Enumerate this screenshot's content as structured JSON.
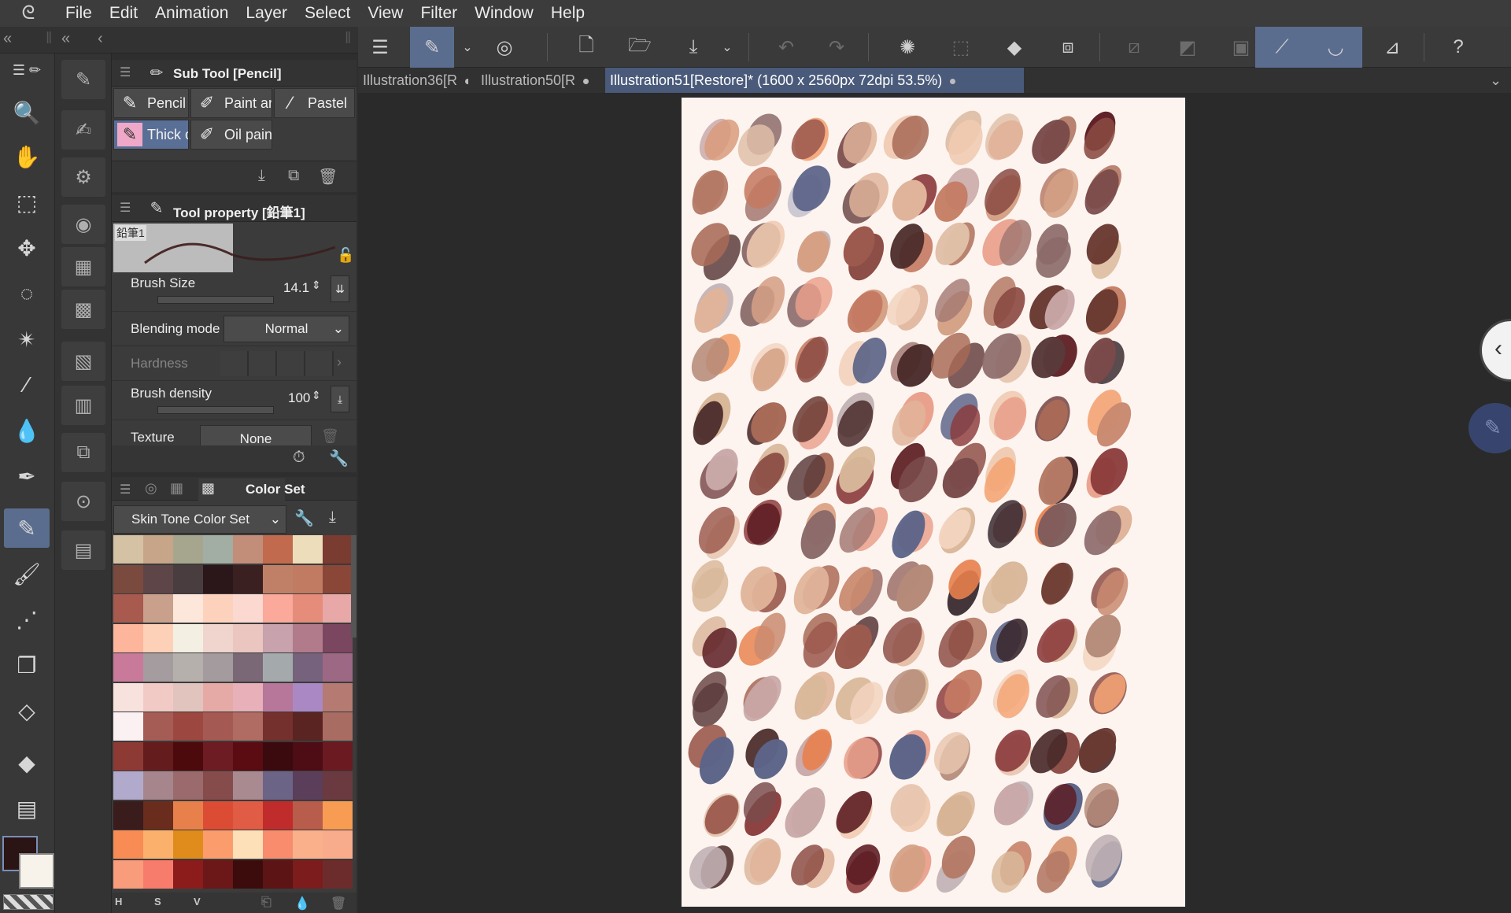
{
  "menubar": {
    "items": [
      "File",
      "Edit",
      "Animation",
      "Layer",
      "Select",
      "View",
      "Filter",
      "Window",
      "Help"
    ]
  },
  "tabs": [
    {
      "label": "Illustration36[R",
      "active": false
    },
    {
      "label": "Illustration50[R",
      "active": false
    },
    {
      "label": "Illustration51[Restore]* (1600 x 2560px 72dpi 53.5%)",
      "active": true
    }
  ],
  "subtool": {
    "title": "Sub Tool [Pencil]",
    "items": [
      {
        "label": "Pencil",
        "icon": "pencil-icon"
      },
      {
        "label": "Paint ar",
        "icon": "paint-icon"
      },
      {
        "label": "Pastel",
        "icon": "pastel-icon"
      },
      {
        "label": "Thick o",
        "icon": "thick-pencil-icon",
        "selected": true
      },
      {
        "label": "Oil pain",
        "icon": "oil-paint-icon"
      }
    ]
  },
  "toolprop": {
    "title": "Tool property [鉛筆1]",
    "preset_name": "鉛筆1",
    "brush_size_label": "Brush Size",
    "brush_size_value": "14.1",
    "blending_label": "Blending mode",
    "blending_value": "Normal",
    "hardness_label": "Hardness",
    "density_label": "Brush density",
    "density_value": "100",
    "texture_label": "Texture",
    "texture_value": "None"
  },
  "colorset": {
    "title": "Color Set",
    "set_name": "Skin Tone Color Set",
    "footer": [
      "H",
      "S",
      "V"
    ],
    "swatches": [
      [
        "#d5c1a3",
        "#c7a588",
        "#a6a68f",
        "#a2ada3",
        "#c28e7a",
        "#c26a4d",
        "#eeddba",
        "#7a3b31"
      ],
      [
        "#7a4a3e",
        "#5e4548",
        "#4a3d40",
        "#2b1619",
        "#3b2022",
        "#c08068",
        "#c07b62",
        "#8a4636"
      ],
      [
        "#a85a4e",
        "#c9a08c",
        "#fde7db",
        "#fdd2bd",
        "#fbd9d0",
        "#faa99b",
        "#e58c7a",
        "#e8a8a8"
      ],
      [
        "#fdb59b",
        "#fdd0b8",
        "#f3f0e3",
        "#efd5cd",
        "#ebc6c1",
        "#c8a2ad",
        "#b17b8c",
        "#7a4660"
      ],
      [
        "#c97a9a",
        "#a59c9f",
        "#b5b0ab",
        "#a49b9e",
        "#7a6876",
        "#a4aaab",
        "#76627c",
        "#9c6884"
      ],
      [
        "#f8e2dd",
        "#f2cac5",
        "#e2c4be",
        "#e6aaa6",
        "#e8b0b8",
        "#b7779a",
        "#aa88c4",
        "#b57a72"
      ],
      [
        "#fbf0f2",
        "#a55c54",
        "#9c473f",
        "#a45a52",
        "#b06b63",
        "#74302c",
        "#5a2422",
        "#a86c62"
      ],
      [
        "#8e3a34",
        "#641c1c",
        "#4c0a0c",
        "#6c1c22",
        "#5a0c12",
        "#3a0a0e",
        "#4e0c14",
        "#6a1a20"
      ],
      [
        "#b2aacc",
        "#a6868c",
        "#9a6a6c",
        "#864c4c",
        "#a88a90",
        "#6c6486",
        "#5a3e5a",
        "#6a3a40"
      ],
      [
        "#3a1c1c",
        "#6a2c1c",
        "#e8804c",
        "#dc4c34",
        "#e05c44",
        "#c02c2c",
        "#b85c4c",
        "#f89c54"
      ],
      [
        "#f88c54",
        "#fbb06c",
        "#e08c1c",
        "#fb9c6c",
        "#fde0b8",
        "#f88c6c",
        "#fbb08c",
        "#f8ac8c"
      ],
      [
        "#f89c7c",
        "#f87c6c",
        "#8c1c1c",
        "#6c1818",
        "#3c0c0c",
        "#5c1414",
        "#7c1c1c",
        "#6c2c2c"
      ]
    ]
  },
  "canvas": {
    "dab_colors": [
      "#b47a66",
      "#c98a70",
      "#8a4a42",
      "#3a2a30",
      "#d9b89a",
      "#c47a62",
      "#e8c6b0",
      "#7a4a4a",
      "#a86a56",
      "#6a3a32",
      "#f0c9b0",
      "#9c5a4e",
      "#d4a084",
      "#5a3a3a",
      "#e0b49a",
      "#8c6a6a",
      "#c9a8a8",
      "#b58a78",
      "#4a2a2a",
      "#f3d4c0",
      "#a57a74",
      "#d99a7a",
      "#7e5c5c",
      "#c0b0b4",
      "#e9a08c",
      "#8a3a3a",
      "#5c1c22",
      "#e8804c",
      "#c8c4d0",
      "#5c6488",
      "#e0c0a8",
      "#f4a474"
    ]
  }
}
